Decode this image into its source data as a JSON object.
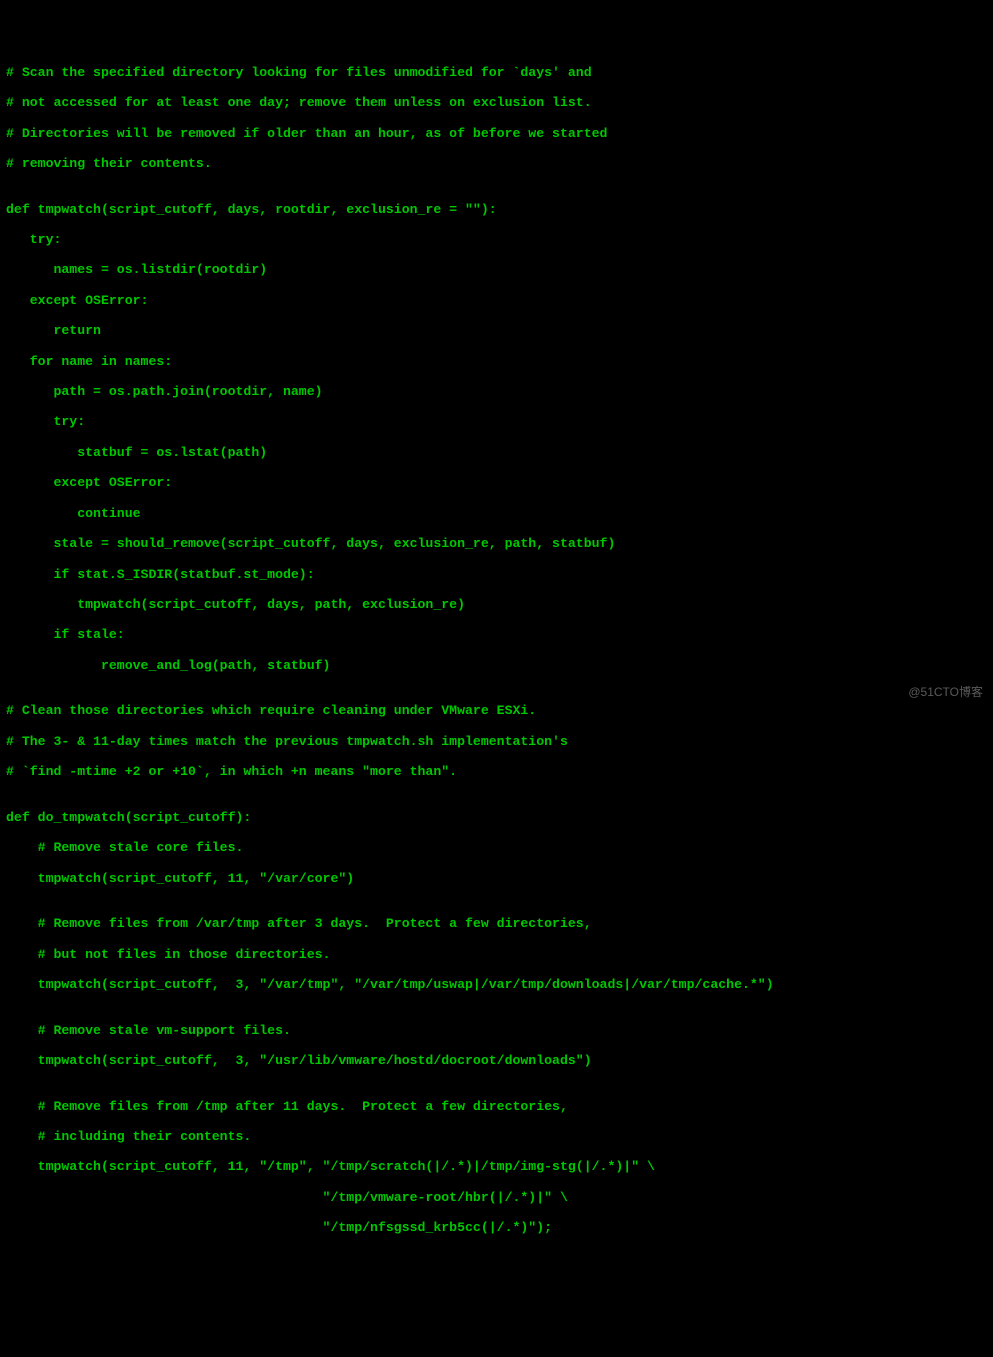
{
  "lines": [
    "# Scan the specified directory looking for files unmodified for `days' and",
    "# not accessed for at least one day; remove them unless on exclusion list.",
    "# Directories will be removed if older than an hour, as of before we started",
    "# removing their contents.",
    "",
    "def tmpwatch(script_cutoff, days, rootdir, exclusion_re = \"\"):",
    "   try:",
    "      names = os.listdir(rootdir)",
    "   except OSError:",
    "      return",
    "   for name in names:",
    "      path = os.path.join(rootdir, name)",
    "      try:",
    "         statbuf = os.lstat(path)",
    "      except OSError:",
    "         continue",
    "      stale = should_remove(script_cutoff, days, exclusion_re, path, statbuf)",
    "      if stat.S_ISDIR(statbuf.st_mode):",
    "         tmpwatch(script_cutoff, days, path, exclusion_re)",
    "      if stale:",
    "            remove_and_log(path, statbuf)",
    "",
    "# Clean those directories which require cleaning under VMware ESXi.",
    "# The 3- & 11-day times match the previous tmpwatch.sh implementation's",
    "# `find -mtime +2 or +10`, in which +n means \"more than\".",
    "",
    "def do_tmpwatch(script_cutoff):",
    "    # Remove stale core files.",
    "    tmpwatch(script_cutoff, 11, \"/var/core\")",
    "",
    "    # Remove files from /var/tmp after 3 days.  Protect a few directories,",
    "    # but not files in those directories.",
    "    tmpwatch(script_cutoff,  3, \"/var/tmp\", \"/var/tmp/uswap|/var/tmp/downloads|/var/tmp/cache.*\")",
    "",
    "    # Remove stale vm-support files.",
    "    tmpwatch(script_cutoff,  3, \"/usr/lib/vmware/hostd/docroot/downloads\")",
    "",
    "    # Remove files from /tmp after 11 days.  Protect a few directories,",
    "    # including their contents.",
    "    tmpwatch(script_cutoff, 11, \"/tmp\", \"/tmp/scratch(|/.*)|/tmp/img-stg(|/.*)|\" \\",
    "                                        \"/tmp/vmware-root/hbr(|/.*)|\" \\",
    "                                        \"/tmp/nfsgssd_krb5cc(|/.*)\");"
  ],
  "watermark": "@51CTO博客"
}
